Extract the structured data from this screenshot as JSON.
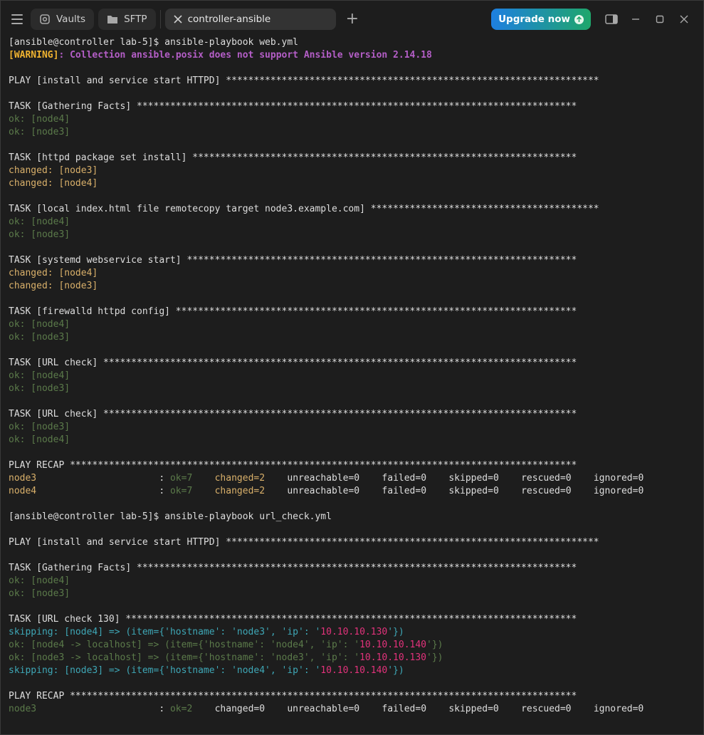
{
  "window": {
    "tabs": [
      {
        "label": "Vaults",
        "icon": "vault-icon"
      },
      {
        "label": "SFTP",
        "icon": "folder-icon"
      },
      {
        "label": "controller-ansible",
        "icon": "close-icon"
      }
    ],
    "upgrade_label": "Upgrade now"
  },
  "colors": {
    "ok": "#5b7a4a",
    "changed": "#d9b06a",
    "skipping": "#3ea7b6",
    "warning": "#f0b330",
    "warning_message": "#b45ec7",
    "ip": "#e2327b",
    "background": "#1d1d1d"
  },
  "terminal": {
    "lines": [
      [
        [
          "plain",
          "[ansible@controller lab-5]$ ansible-playbook web.yml"
        ]
      ],
      [
        [
          "warn",
          "[WARNING]"
        ],
        [
          "warnmsg",
          ": Collection ansible.posix does not support Ansible version 2.14.18"
        ]
      ],
      [],
      [
        [
          "plain",
          "PLAY [install and service start HTTPD] *******************************************************************"
        ]
      ],
      [],
      [
        [
          "plain",
          "TASK [Gathering Facts] *******************************************************************************"
        ]
      ],
      [
        [
          "ok",
          "ok: [node4]"
        ]
      ],
      [
        [
          "ok",
          "ok: [node3]"
        ]
      ],
      [],
      [
        [
          "plain",
          "TASK [httpd package set install] *********************************************************************"
        ]
      ],
      [
        [
          "changed",
          "changed: [node3]"
        ]
      ],
      [
        [
          "changed",
          "changed: [node4]"
        ]
      ],
      [],
      [
        [
          "plain",
          "TASK [local index.html file remotecopy target node3.example.com] *****************************************"
        ]
      ],
      [
        [
          "ok",
          "ok: [node4]"
        ]
      ],
      [
        [
          "ok",
          "ok: [node3]"
        ]
      ],
      [],
      [
        [
          "plain",
          "TASK [systemd webservice start] **********************************************************************"
        ]
      ],
      [
        [
          "changed",
          "changed: [node4]"
        ]
      ],
      [
        [
          "changed",
          "changed: [node3]"
        ]
      ],
      [],
      [
        [
          "plain",
          "TASK [firewalld httpd config] ************************************************************************"
        ]
      ],
      [
        [
          "ok",
          "ok: [node4]"
        ]
      ],
      [
        [
          "ok",
          "ok: [node3]"
        ]
      ],
      [],
      [
        [
          "plain",
          "TASK [URL check] *************************************************************************************"
        ]
      ],
      [
        [
          "ok",
          "ok: [node4]"
        ]
      ],
      [
        [
          "ok",
          "ok: [node3]"
        ]
      ],
      [],
      [
        [
          "plain",
          "TASK [URL check] *************************************************************************************"
        ]
      ],
      [
        [
          "ok",
          "ok: [node3]"
        ]
      ],
      [
        [
          "ok",
          "ok: [node4]"
        ]
      ],
      [],
      [
        [
          "plain",
          "PLAY RECAP *******************************************************************************************"
        ]
      ],
      [
        [
          "changed",
          "node3"
        ],
        [
          "plain",
          "                      : "
        ],
        [
          "ok",
          "ok=7"
        ],
        [
          "plain",
          "    "
        ],
        [
          "changed",
          "changed=2"
        ],
        [
          "plain",
          "    unreachable=0    failed=0    skipped=0    rescued=0    ignored=0"
        ]
      ],
      [
        [
          "changed",
          "node4"
        ],
        [
          "plain",
          "                      : "
        ],
        [
          "ok",
          "ok=7"
        ],
        [
          "plain",
          "    "
        ],
        [
          "changed",
          "changed=2"
        ],
        [
          "plain",
          "    unreachable=0    failed=0    skipped=0    rescued=0    ignored=0"
        ]
      ],
      [],
      [
        [
          "plain",
          "[ansible@controller lab-5]$ ansible-playbook url_check.yml"
        ]
      ],
      [],
      [
        [
          "plain",
          "PLAY [install and service start HTTPD] *******************************************************************"
        ]
      ],
      [],
      [
        [
          "plain",
          "TASK [Gathering Facts] *******************************************************************************"
        ]
      ],
      [
        [
          "ok",
          "ok: [node4]"
        ]
      ],
      [
        [
          "ok",
          "ok: [node3]"
        ]
      ],
      [],
      [
        [
          "plain",
          "TASK [URL check 130] *********************************************************************************"
        ]
      ],
      [
        [
          "skip",
          "skipping: [node4] => (item={'hostname': 'node3', 'ip': '"
        ],
        [
          "ip",
          "10.10.10.130"
        ],
        [
          "skip",
          "'})"
        ]
      ],
      [
        [
          "ok",
          "ok: [node4 -> localhost] => (item={'hostname': 'node4', 'ip': '"
        ],
        [
          "ip",
          "10.10.10.140"
        ],
        [
          "ok",
          "'})"
        ]
      ],
      [
        [
          "ok",
          "ok: [node3 -> localhost] => (item={'hostname': 'node3', 'ip': '"
        ],
        [
          "ip",
          "10.10.10.130"
        ],
        [
          "ok",
          "'})"
        ]
      ],
      [
        [
          "skip",
          "skipping: [node3] => (item={'hostname': 'node4', 'ip': '"
        ],
        [
          "ip",
          "10.10.10.140"
        ],
        [
          "skip",
          "'})"
        ]
      ],
      [],
      [
        [
          "plain",
          "PLAY RECAP *******************************************************************************************"
        ]
      ],
      [
        [
          "ok",
          "node3"
        ],
        [
          "plain",
          "                      : "
        ],
        [
          "ok",
          "ok=2"
        ],
        [
          "plain",
          "    changed=0    unreachable=0    failed=0    skipped=0    rescued=0    ignored=0"
        ]
      ]
    ]
  }
}
